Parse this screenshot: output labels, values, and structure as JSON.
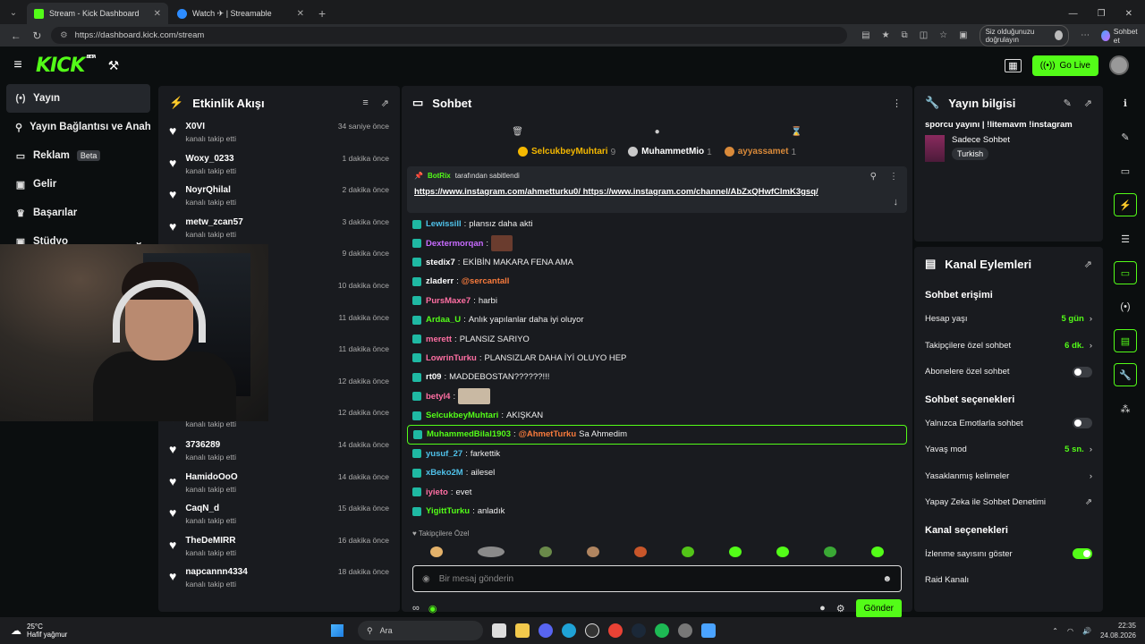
{
  "browser": {
    "tabs": [
      {
        "title": "Stream - Kick Dashboard",
        "color": "#53fc18"
      },
      {
        "title": "Watch ✈ | Streamable",
        "color": "#2d8cff"
      }
    ],
    "url": "https://dashboard.kick.com/stream",
    "verify_label": "Siz olduğunuzu doğrulayın",
    "chat_label": "Sohbet et"
  },
  "topbar": {
    "logo": "KICK",
    "logo_sup": "BETA",
    "golive_label": "Go Live"
  },
  "sidebar": {
    "items": [
      {
        "label": "Yayın",
        "icon": "(•)"
      },
      {
        "label": "Yayın Bağlantısı ve Anahtar",
        "icon": "⚲"
      },
      {
        "label": "Reklam",
        "icon": "▭",
        "badge": "Beta"
      },
      {
        "label": "Gelir",
        "icon": "▣"
      },
      {
        "label": "Başarılar",
        "icon": "♛"
      },
      {
        "label": "Stüdyo",
        "icon": "▣"
      }
    ]
  },
  "activity": {
    "title": "Etkinlik Akışı",
    "items": [
      {
        "name": "X0VI",
        "sub": "kanalı takip etti",
        "time": "34 saniye önce"
      },
      {
        "name": "Woxy_0233",
        "sub": "kanalı takip etti",
        "time": "1 dakika önce"
      },
      {
        "name": "NoyrQhilal",
        "sub": "kanalı takip etti",
        "time": "2 dakika önce"
      },
      {
        "name": "metw_zcan57",
        "sub": "kanalı takip etti",
        "time": "3 dakika önce"
      },
      {
        "name": "",
        "sub": "",
        "time": "9 dakika önce"
      },
      {
        "name": "",
        "sub": "",
        "time": "10 dakika önce"
      },
      {
        "name": "",
        "sub": "",
        "time": "11 dakika önce"
      },
      {
        "name": "",
        "sub": "",
        "time": "11 dakika önce"
      },
      {
        "name": "",
        "sub": "",
        "time": "12 dakika önce"
      },
      {
        "name": "",
        "sub": "kanalı takip etti",
        "time": "12 dakika önce"
      },
      {
        "name": "3736289",
        "sub": "kanalı takip etti",
        "time": "14 dakika önce"
      },
      {
        "name": "HamidoOoO",
        "sub": "kanalı takip etti",
        "time": "14 dakika önce"
      },
      {
        "name": "CaqN_d",
        "sub": "kanalı takip etti",
        "time": "15 dakika önce"
      },
      {
        "name": "TheDeMIRR",
        "sub": "kanalı takip etti",
        "time": "16 dakika önce"
      },
      {
        "name": "napcannn4334",
        "sub": "kanalı takip etti",
        "time": "18 dakika önce"
      }
    ]
  },
  "chat": {
    "title": "Sohbet",
    "podium": [
      {
        "name": "SelcukbeyMuhtari",
        "count": "9",
        "color": "#f5b800",
        "rank": "1"
      },
      {
        "name": "MuhammetMio",
        "count": "1",
        "color": "#c9c9c9",
        "rank": "2"
      },
      {
        "name": "ayyassamet",
        "count": "1",
        "color": "#d98a3a",
        "rank": "3"
      }
    ],
    "pinned": {
      "by": "BotRix",
      "by_suffix": "tarafından sabitlendi",
      "links": "https://www.instagram.com/ahmetturku0/ https://www.instagram.com/channel/AbZxQHwfClmK3gsq/"
    },
    "messages": [
      {
        "user": "Lewissill",
        "color": "#4fc1e9",
        "text": "plansız daha akti",
        "emote": false
      },
      {
        "user": "Dextermorqan",
        "color": "#c86bff",
        "text": "",
        "emote": true
      },
      {
        "user": "stedix7",
        "color": "#ffffff",
        "text": "EKİBİN MAKARA FENA AMA",
        "emote": false
      },
      {
        "user": "zladerr",
        "color": "#ffffff",
        "text": "",
        "mention": "@sercantall",
        "emote": false
      },
      {
        "user": "PursMaxe7",
        "color": "#ff6fa3",
        "text": "harbi",
        "emote": false
      },
      {
        "user": "Ardaa_U",
        "color": "#53fc18",
        "text": "Anlık yapılanlar daha iyi oluyor",
        "emote": false
      },
      {
        "user": "merett",
        "color": "#ff6fa3",
        "text": "PLANSIZ SARIYO",
        "emote": false
      },
      {
        "user": "LowrinTurku",
        "color": "#ff6fa3",
        "text": "PLANSIZLAR DAHA İYİ OLUYO HEP",
        "emote": false
      },
      {
        "user": "rt09",
        "color": "#ffffff",
        "text": "MADDEBOSTAN??????!!!",
        "emote": false
      },
      {
        "user": "betyl4",
        "color": "#ff6fa3",
        "text": "",
        "emote": true
      },
      {
        "user": "SelcukbeyMuhtari",
        "color": "#53fc18",
        "text": "AKIŞKAN",
        "emote": false
      },
      {
        "user": "MuhammedBilal1903",
        "color": "#53fc18",
        "text": "Sa Ahmedim",
        "mention": "@AhmetTurku",
        "highlight": true,
        "emote": false
      },
      {
        "user": "yusuf_27",
        "color": "#4fc1e9",
        "text": "farkettik",
        "emote": false
      },
      {
        "user": "xBeko2M",
        "color": "#4fc1e9",
        "text": "ailesel",
        "emote": false
      },
      {
        "user": "iyieto",
        "color": "#ff6fa3",
        "text": "evet",
        "emote": false
      },
      {
        "user": "YigittTurku",
        "color": "#53fc18",
        "text": "anladık",
        "emote": false
      }
    ],
    "subonly": "Takipçilere Özel",
    "placeholder": "Bir mesaj gönderin",
    "send_label": "Gönder"
  },
  "info": {
    "title": "Yayın bilgisi",
    "stream_title": "sporcu yayını | !litemavm !instagram",
    "category": "Sadece Sohbet",
    "tag": "Turkish"
  },
  "actions": {
    "title": "Kanal Eylemleri",
    "section_access": "Sohbet erişimi",
    "account_age": {
      "label": "Hesap yaşı",
      "value": "5 gün"
    },
    "followers_only": {
      "label": "Takipçilere özel sohbet",
      "value": "6 dk."
    },
    "subs_only": {
      "label": "Abonelere özel sohbet"
    },
    "section_options": "Sohbet seçenekleri",
    "emote_only": {
      "label": "Yalnızca Emotlarla sohbet"
    },
    "slow_mode": {
      "label": "Yavaş mod",
      "value": "5 sn."
    },
    "banned_words": {
      "label": "Yasaklanmış kelimeler"
    },
    "ai_moderation": {
      "label": "Yapay Zeka ile Sohbet Denetimi"
    },
    "section_channel": "Kanal seçenekleri",
    "viewer_count": {
      "label": "İzlenme sayısını göster"
    },
    "raid": {
      "label": "Raid Kanalı"
    }
  },
  "taskbar": {
    "temp": "25°C",
    "weather": "Hafif yağmur",
    "search": "Ara",
    "time": "22:35",
    "date": "24.08.2026"
  }
}
